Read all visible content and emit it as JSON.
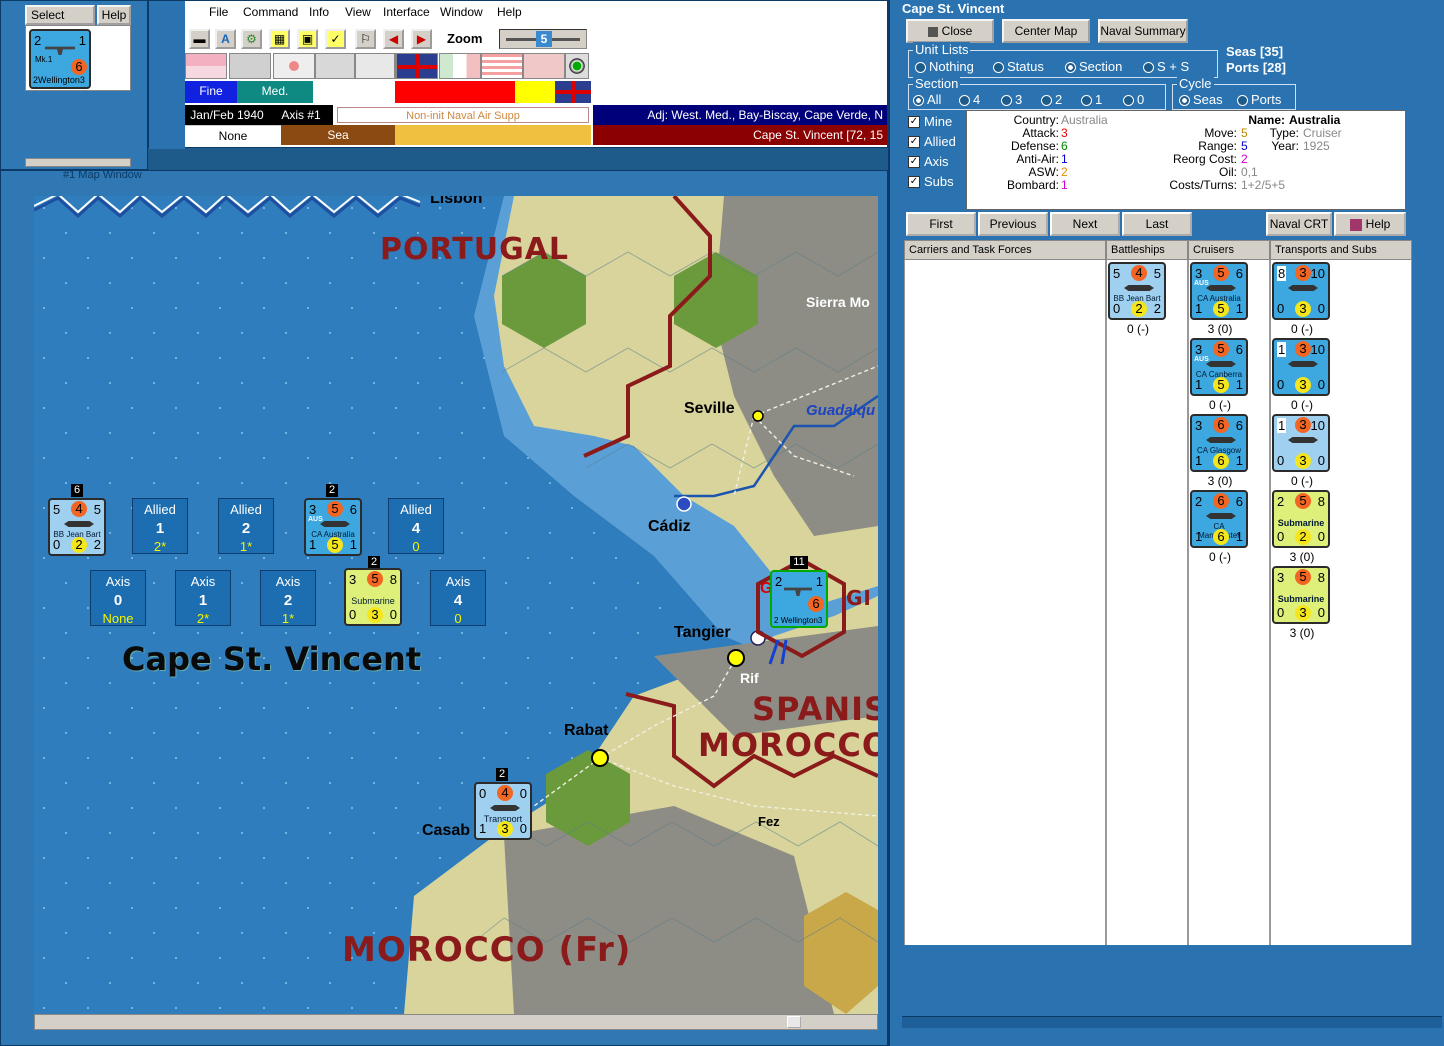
{
  "select_window": {
    "tabs": [
      "Select",
      "Help"
    ],
    "unit": {
      "top_left": "2",
      "top_right": "1",
      "attack": "6",
      "bottom_left": "2",
      "bottom_right": "3",
      "sub": "Mk.1",
      "name": "Wellington"
    }
  },
  "menu": {
    "items": [
      "File",
      "Command",
      "Info",
      "View",
      "Interface",
      "Window",
      "Help"
    ],
    "zoom_label": "Zoom",
    "zoom_value": "5"
  },
  "status": {
    "weather_a": "Fine",
    "weather_b": "Med.",
    "date": "Jan/Feb 1940",
    "phase": "Axis #1",
    "action": "Non-init Naval Air Supp",
    "adjacent": "Adj: West. Med., Bay-Biscay, Cape Verde, N",
    "terrain_a": "None",
    "terrain_b": "Sea",
    "location": "Cape St. Vincent [72, 15"
  },
  "map_window": {
    "title": "#1 Map Window",
    "labels": {
      "lisbon": "Lisbon",
      "portugal": "PORTUGAL",
      "sierra": "Sierra Mo",
      "seville": "Seville",
      "guadal": "Guadalqu",
      "cadiz": "Cádiz",
      "gib": "Gib",
      "gi": "GI",
      "tangier": "Tangier",
      "rif": "Rif",
      "spanish": "SPANIS",
      "morocco": "MOROCCO",
      "rabat": "Rabat",
      "casab": "Casab",
      "fez": "Fez",
      "morocco_fr": "MOROCCO (Fr)",
      "sea_name": "Cape St. Vincent"
    },
    "sea_boxes_allied": [
      {
        "label": "Allied",
        "num": "1",
        "val": "2*"
      },
      {
        "label": "Allied",
        "num": "2",
        "val": "1*"
      },
      {
        "label": "Allied",
        "num": "4",
        "val": "0"
      }
    ],
    "sea_boxes_axis": [
      {
        "label": "Axis",
        "num": "0",
        "val": "None"
      },
      {
        "label": "Axis",
        "num": "1",
        "val": "2*"
      },
      {
        "label": "Axis",
        "num": "2",
        "val": "1*"
      },
      {
        "label": "Axis",
        "num": "4",
        "val": "0"
      }
    ],
    "stack_counts": {
      "bb": "6",
      "ca": "2",
      "sub": "2",
      "transport": "2",
      "gib": "11"
    },
    "counters": {
      "bb": {
        "a": "5",
        "b": "4",
        "c": "5",
        "d": "0",
        "e": "2",
        "f": "2",
        "name": "BB Jean Bart"
      },
      "ca": {
        "a": "3",
        "b": "5",
        "c": "6",
        "d": "1",
        "e": "5",
        "f": "1",
        "name": "CA Australia",
        "nat": "AUS"
      },
      "sub": {
        "a": "3",
        "b": "5",
        "c": "8",
        "d": "0",
        "e": "3",
        "f": "0",
        "name": "Submarine"
      },
      "transport": {
        "a": "0",
        "b": "4",
        "c": "0",
        "d": "1",
        "e": "3",
        "f": "0",
        "name": "Transport"
      },
      "gib": {
        "a": "2",
        "b": "6",
        "c": "1",
        "d": "2",
        "f": "3",
        "name": "Wellington"
      }
    }
  },
  "panel": {
    "title": "Cape St. Vincent",
    "buttons": {
      "close": "Close",
      "center": "Center Map",
      "naval": "Naval Summary"
    },
    "unit_lists": {
      "legend": "Unit Lists",
      "options": [
        "Nothing",
        "Status",
        "Section",
        "S + S"
      ],
      "selected": "Section"
    },
    "seas": "Seas [35]",
    "ports": "Ports [28]",
    "section": {
      "legend": "Section",
      "options": [
        "All",
        "4",
        "3",
        "2",
        "1",
        "0"
      ],
      "selected": "All"
    },
    "cycle": {
      "legend": "Cycle",
      "options": [
        "Seas",
        "Ports"
      ],
      "selected": "Seas"
    },
    "filters": [
      "Mine",
      "Allied",
      "Axis",
      "Subs"
    ],
    "info": {
      "country_label": "Country:",
      "country": "Australia",
      "attack_label": "Attack:",
      "attack": "3",
      "defense_label": "Defense:",
      "defense": "6",
      "antiair_label": "Anti-Air:",
      "antiair": "1",
      "asw_label": "ASW:",
      "asw": "2",
      "bombard_label": "Bombard:",
      "bombard": "1",
      "move_label": "Move:",
      "move": "5",
      "range_label": "Range:",
      "range": "5",
      "reorg_label": "Reorg Cost:",
      "reorg": "2",
      "oil_label": "Oil:",
      "oil": "0,1",
      "costs_label": "Costs/Turns:",
      "costs": "1+2/5+5",
      "name_label": "Name:",
      "name": "Australia",
      "type_label": "Type:",
      "type": "Cruiser",
      "year_label": "Year:",
      "year": "1925"
    },
    "nav": {
      "first": "First",
      "previous": "Previous",
      "next": "Next",
      "last": "Last",
      "crt": "Naval CRT",
      "help": "Help"
    },
    "columns": [
      "Carriers and Task Forces",
      "Battleships",
      "Cruisers",
      "Transports and Subs"
    ],
    "battleships": [
      {
        "a": "5",
        "b": "4",
        "c": "5",
        "d": "0",
        "e": "2",
        "f": "2",
        "name": "BB Jean Bart",
        "count": "0 (-)"
      }
    ],
    "cruisers": [
      {
        "a": "3",
        "b": "5",
        "c": "6",
        "d": "1",
        "e": "5",
        "f": "1",
        "name": "CA Australia",
        "nat": "AUS",
        "count": "3 (0)"
      },
      {
        "a": "3",
        "b": "5",
        "c": "6",
        "d": "1",
        "e": "5",
        "f": "1",
        "name": "CA Canberra",
        "nat": "AUS",
        "count": "0 (-)"
      },
      {
        "a": "3",
        "b": "6",
        "c": "6",
        "d": "1",
        "e": "6",
        "f": "1",
        "name": "CA Glasgow",
        "nat": "",
        "count": "3 (0)"
      },
      {
        "a": "2",
        "b": "6",
        "c": "6",
        "d": "1",
        "e": "6",
        "f": "1",
        "name": "CA Manchester",
        "nat": "",
        "count": "0 (-)"
      }
    ],
    "transports": [
      {
        "a": "8",
        "b": "3",
        "c": "10",
        "d": "0",
        "e": "3",
        "f": "0",
        "name": "",
        "count": "0 (-)"
      },
      {
        "a": "1",
        "b": "3",
        "c": "10",
        "d": "0",
        "e": "3",
        "f": "0",
        "name": "",
        "count": "0 (-)"
      },
      {
        "a": "1",
        "b": "3",
        "c": "10",
        "d": "0",
        "e": "3",
        "f": "0",
        "name": "",
        "count": "0 (-)"
      },
      {
        "a": "2",
        "b": "5",
        "c": "8",
        "d": "0",
        "e": "2",
        "f": "0",
        "name": "Submarine",
        "count": "3 (0)"
      },
      {
        "a": "3",
        "b": "5",
        "c": "8",
        "d": "0",
        "e": "3",
        "f": "0",
        "name": "Submarine",
        "count": "3 (0)"
      }
    ]
  }
}
